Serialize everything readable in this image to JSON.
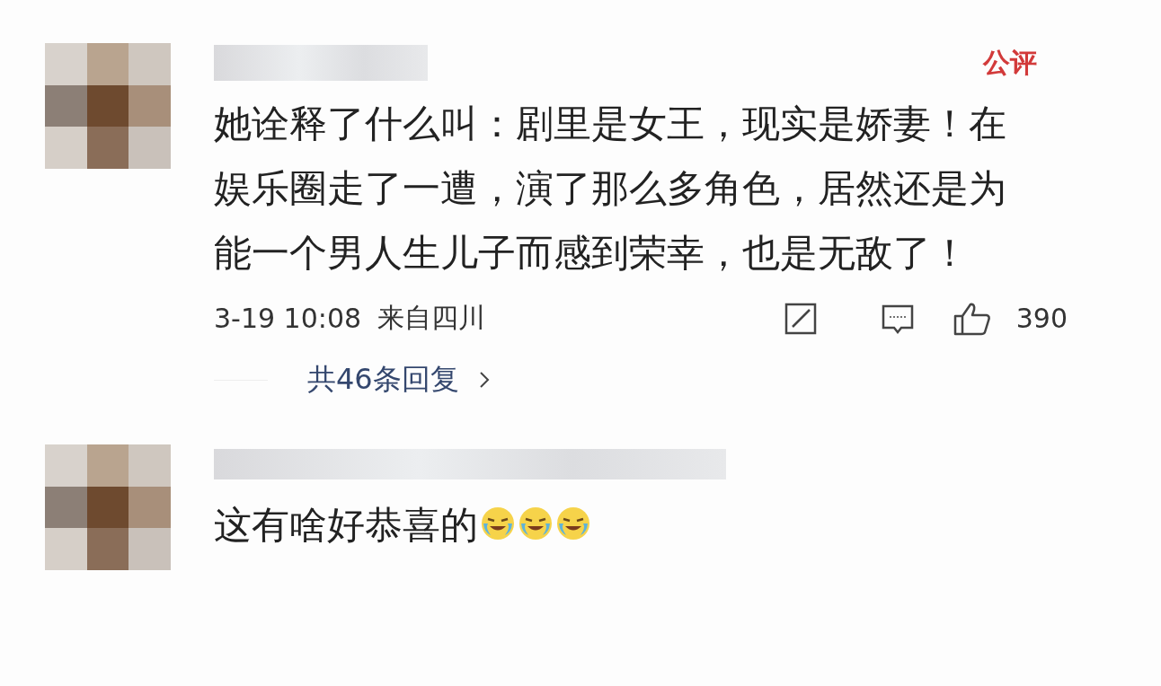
{
  "comments": [
    {
      "badge": "公评",
      "text": "她诠释了什么叫：剧里是女王，现实是娇妻！在娱乐圈走了一遭，演了那么多角色，居然还是为能一个男人生儿子而感到荣幸，也是无敌了！",
      "time": "3-19 10:08",
      "location": "来自四川",
      "likes": "390",
      "replies_link": "共46条回复"
    },
    {
      "text": "这有啥好恭喜的",
      "trailing_icons": [
        {
          "kind": "laughing-tears"
        },
        {
          "kind": "laughing-tears"
        },
        {
          "kind": "laughing-tears"
        }
      ]
    }
  ]
}
